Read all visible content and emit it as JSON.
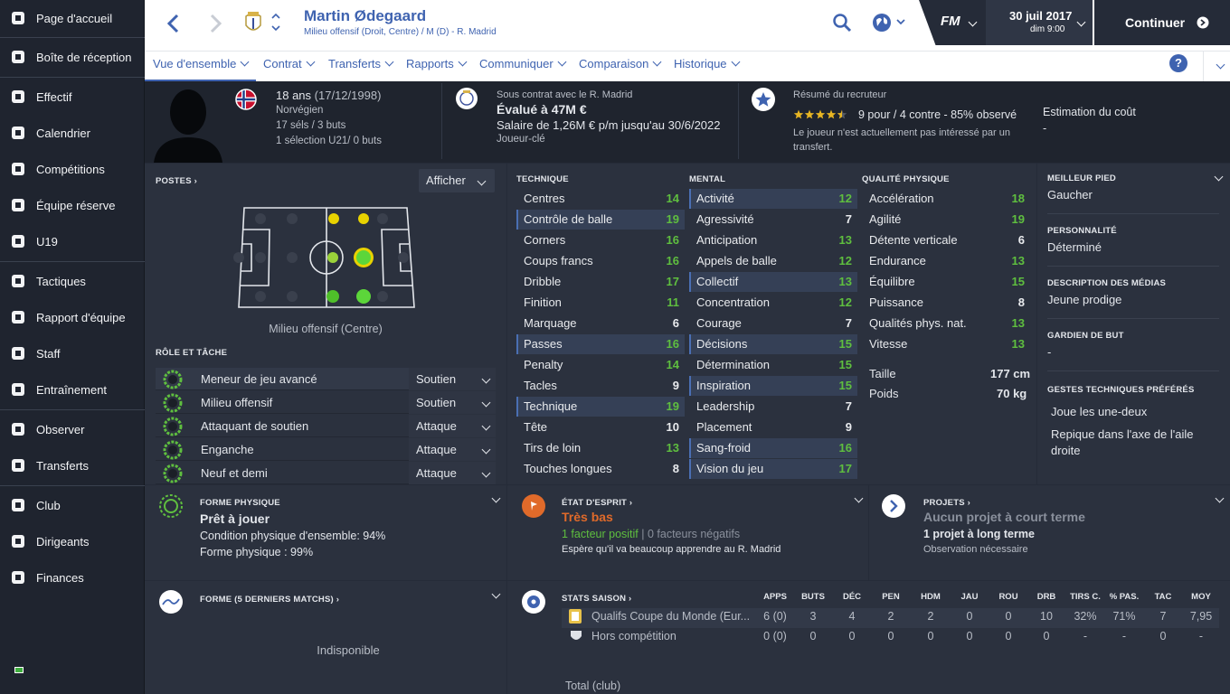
{
  "sidebar": {
    "items": [
      {
        "label": "Page d'accueil",
        "icon": "home-icon"
      },
      {
        "label": "Boîte de réception",
        "icon": "inbox-icon"
      },
      {
        "label": "Effectif",
        "icon": "squad-icon"
      },
      {
        "label": "Calendrier",
        "icon": "calendar-icon"
      },
      {
        "label": "Compétitions",
        "icon": "trophy-icon"
      },
      {
        "label": "Équipe réserve",
        "icon": "reserve-team-icon"
      },
      {
        "label": "U19",
        "icon": "u19-icon"
      },
      {
        "label": "Tactiques",
        "icon": "tactics-icon"
      },
      {
        "label": "Rapport d'équipe",
        "icon": "team-report-icon"
      },
      {
        "label": "Staff",
        "icon": "staff-icon"
      },
      {
        "label": "Entraînement",
        "icon": "training-icon"
      },
      {
        "label": "Observer",
        "icon": "scouting-icon"
      },
      {
        "label": "Transferts",
        "icon": "transfers-icon"
      },
      {
        "label": "Club",
        "icon": "club-icon"
      },
      {
        "label": "Dirigeants",
        "icon": "board-icon"
      },
      {
        "label": "Finances",
        "icon": "finances-icon"
      }
    ]
  },
  "header": {
    "player_name": "Martin Ødegaard",
    "subtitle": "Milieu offensif (Droit, Centre) / M (D) - R. Madrid",
    "fm_label": "FM",
    "date": "30 juil 2017",
    "time": "dim 9:00",
    "continue_label": "Continuer"
  },
  "tabs": [
    "Vue d'ensemble",
    "Contrat",
    "Transferts",
    "Rapports",
    "Communiquer",
    "Comparaison",
    "Historique"
  ],
  "info": {
    "age": "18 ans",
    "dob": "(17/12/1998)",
    "nationality": "Norvégien",
    "caps": "17 séls / 3 buts",
    "u21": "1 sélection U21/ 0 buts",
    "contract": "Sous contrat avec le R. Madrid",
    "value": "Évalué à 47M €",
    "salary": "Salaire de 1,26M € p/m jusqu'au 30/6/2022",
    "status": "Joueur-clé",
    "scout_title": "Résumé du recruteur",
    "stars": 4.5,
    "scout_rating": "9 pour / 4 contre - 85% observé",
    "scout_note": "Le joueur n'est actuellement pas intéressé par un transfert.",
    "cost_title": "Estimation du coût",
    "cost_value": "-"
  },
  "positions": {
    "title": "POSTES",
    "show_label": "Afficher",
    "caption": "Milieu offensif (Centre)"
  },
  "roles_title": "RÔLE ET TÂCHE",
  "roles": [
    {
      "name": "Meneur de jeu avancé",
      "duty": "Soutien"
    },
    {
      "name": "Milieu offensif",
      "duty": "Soutien"
    },
    {
      "name": "Attaquant de soutien",
      "duty": "Attaque"
    },
    {
      "name": "Enganche",
      "duty": "Attaque"
    },
    {
      "name": "Neuf et demi",
      "duty": "Attaque"
    }
  ],
  "technical": {
    "title": "TECHNIQUE",
    "attrs": [
      [
        "Centres",
        "14"
      ],
      [
        "Contrôle de balle",
        "19"
      ],
      [
        "Corners",
        "16"
      ],
      [
        "Coups francs",
        "16"
      ],
      [
        "Dribble",
        "17"
      ],
      [
        "Finition",
        "11"
      ],
      [
        "Marquage",
        "6"
      ],
      [
        "Passes",
        "16"
      ],
      [
        "Penalty",
        "14"
      ],
      [
        "Tacles",
        "9"
      ],
      [
        "Technique",
        "19"
      ],
      [
        "Tête",
        "10"
      ],
      [
        "Tirs de loin",
        "13"
      ],
      [
        "Touches longues",
        "8"
      ]
    ]
  },
  "mental": {
    "title": "MENTAL",
    "attrs": [
      [
        "Activité",
        "12"
      ],
      [
        "Agressivité",
        "7"
      ],
      [
        "Anticipation",
        "13"
      ],
      [
        "Appels de balle",
        "12"
      ],
      [
        "Collectif",
        "13"
      ],
      [
        "Concentration",
        "12"
      ],
      [
        "Courage",
        "7"
      ],
      [
        "Décisions",
        "15"
      ],
      [
        "Détermination",
        "15"
      ],
      [
        "Inspiration",
        "15"
      ],
      [
        "Leadership",
        "7"
      ],
      [
        "Placement",
        "9"
      ],
      [
        "Sang-froid",
        "16"
      ],
      [
        "Vision du jeu",
        "17"
      ]
    ]
  },
  "physical": {
    "title": "QUALITÉ PHYSIQUE",
    "attrs": [
      [
        "Accélération",
        "18"
      ],
      [
        "Agilité",
        "19"
      ],
      [
        "Détente verticale",
        "6"
      ],
      [
        "Endurance",
        "13"
      ],
      [
        "Équilibre",
        "15"
      ],
      [
        "Puissance",
        "8"
      ],
      [
        "Qualités phys. nat.",
        "13"
      ],
      [
        "Vitesse",
        "13"
      ]
    ],
    "height_label": "Taille",
    "height": "177 cm",
    "weight_label": "Poids",
    "weight": "70 kg"
  },
  "profile": {
    "foot_label": "MEILLEUR PIED",
    "foot": "Gaucher",
    "pers_label": "PERSONNALITÉ",
    "pers": "Déterminé",
    "media_label": "DESCRIPTION DES MÉDIAS",
    "media": "Jeune prodige",
    "gk_label": "GARDIEN DE BUT",
    "gk": "-",
    "moves_label": "GESTES TECHNIQUES PRÉFÉRÉS",
    "move1": "Joue les une-deux",
    "move2": "Repique dans l'axe de l'aile droite"
  },
  "fitness": {
    "title": "FORME PHYSIQUE",
    "status": "Prêt à jouer",
    "condition": "Condition physique d'ensemble: 94%",
    "form": "Forme physique : 99%"
  },
  "morale": {
    "title": "ÉTAT D'ESPRIT",
    "status": "Très bas",
    "positive": "1 facteur positif",
    "sep": " | ",
    "negative": "0 facteurs négatifs",
    "note": "Espère qu'il va beaucoup apprendre au R. Madrid"
  },
  "projects": {
    "title": "PROJETS",
    "short": "Aucun projet à court terme",
    "long": "1 projet à long terme",
    "note": "Observation nécessaire"
  },
  "form5": {
    "title": "FORME (5 DERNIERS MATCHS)",
    "unavailable": "Indisponible"
  },
  "season": {
    "title": "STATS SAISON",
    "cols": [
      "APPS",
      "BUTS",
      "DÉC",
      "PEN",
      "HDM",
      "JAU",
      "ROU",
      "DRB",
      "TIRS C.",
      "% PAS.",
      "TAC",
      "MOY"
    ],
    "rows": [
      {
        "comp": "Qualifs Coupe du Monde (Eur...",
        "vals": [
          "6 (0)",
          "3",
          "4",
          "2",
          "2",
          "0",
          "0",
          "10",
          "32%",
          "71%",
          "7",
          "7,95"
        ]
      },
      {
        "comp": "Hors compétition",
        "vals": [
          "0 (0)",
          "0",
          "0",
          "0",
          "0",
          "0",
          "0",
          "0",
          "-",
          "-",
          "0",
          "-"
        ]
      }
    ],
    "total": "Total (club)"
  },
  "colors": {
    "accent": "#3f63b0",
    "green": "#5fbf3f",
    "orange": "#e06a2a",
    "yellow": "#e8d200"
  }
}
